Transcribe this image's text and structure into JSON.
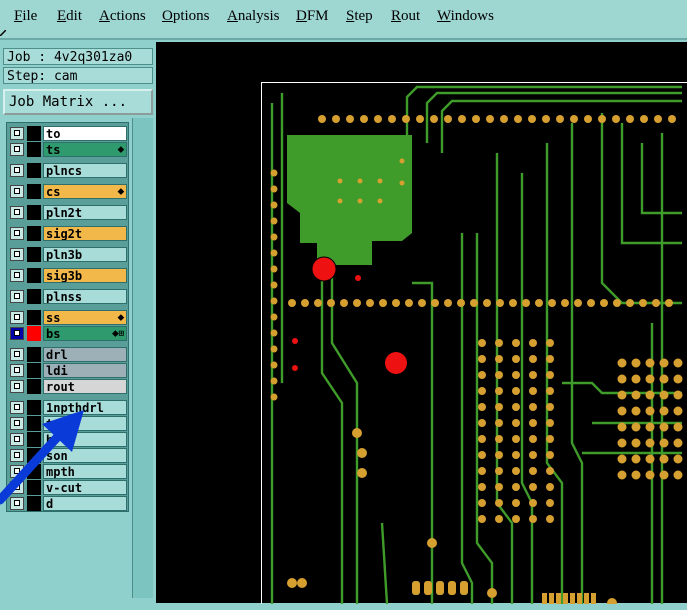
{
  "menu": {
    "items": [
      {
        "label": "File",
        "ul": "F",
        "rest": "ile"
      },
      {
        "label": "Edit",
        "ul": "E",
        "rest": "dit"
      },
      {
        "label": "Actions",
        "ul": "A",
        "rest": "ctions"
      },
      {
        "label": "Options",
        "ul": "O",
        "rest": "ptions"
      },
      {
        "label": "Analysis",
        "ul": "A",
        "rest": "nalysis"
      },
      {
        "label": "DFM",
        "ul": "D",
        "rest": "FM"
      },
      {
        "label": "Step",
        "ul": "S",
        "rest": "tep"
      },
      {
        "label": "Rout",
        "ul": "R",
        "rest": "out"
      },
      {
        "label": "Windows",
        "ul": "W",
        "rest": "indows"
      }
    ]
  },
  "job": {
    "label": "Job : 4v2q301za0",
    "step": "Step: cam",
    "matrix_button": "Job Matrix ..."
  },
  "layers": [
    {
      "name": "to",
      "color": "#ffffff",
      "swatch": "#000000",
      "tag": ""
    },
    {
      "name": "ts",
      "color": "#2e9a6e",
      "swatch": "#000000",
      "tag": "⬥"
    },
    {
      "name": "plncs",
      "color": "#a8dcd8",
      "swatch": "#000000",
      "tag": ""
    },
    {
      "name": "cs",
      "color": "#f3b84a",
      "swatch": "#000000",
      "tag": "⬥"
    },
    {
      "name": "pln2t",
      "color": "#a8dcd8",
      "swatch": "#000000",
      "tag": ""
    },
    {
      "name": "sig2t",
      "color": "#f3b84a",
      "swatch": "#000000",
      "tag": ""
    },
    {
      "name": "pln3b",
      "color": "#a8dcd8",
      "swatch": "#000000",
      "tag": ""
    },
    {
      "name": "sig3b",
      "color": "#f3b84a",
      "swatch": "#000000",
      "tag": ""
    },
    {
      "name": "plnss",
      "color": "#a8dcd8",
      "swatch": "#000000",
      "tag": ""
    },
    {
      "name": "ss",
      "color": "#f3b84a",
      "swatch": "#000000",
      "tag": "⬥"
    },
    {
      "name": "bs",
      "color": "#2e9a6e",
      "swatch": "#ff0000",
      "tag": "⬥⊞"
    },
    {
      "name": "drl",
      "color": "#9db0b8",
      "swatch": "#000000",
      "tag": ""
    },
    {
      "name": "ldi",
      "color": "#9db0b8",
      "swatch": "#000000",
      "tag": ""
    },
    {
      "name": "rout",
      "color": "#d6d6d6",
      "swatch": "#000000",
      "tag": ""
    },
    {
      "name": "1npthdrl",
      "color": "#a8dcd8",
      "swatch": "#000000",
      "tag": ""
    },
    {
      "name": "tp",
      "color": "#a8dcd8",
      "swatch": "#000000",
      "tag": ""
    },
    {
      "name": "b",
      "color": "#a8dcd8",
      "swatch": "#000000",
      "tag": ""
    },
    {
      "name": "son",
      "color": "#a8dcd8",
      "swatch": "#000000",
      "tag": ""
    },
    {
      "name": "mpth",
      "color": "#a8dcd8",
      "swatch": "#000000",
      "tag": ""
    },
    {
      "name": "v-cut",
      "color": "#a8dcd8",
      "swatch": "#000000",
      "tag": ""
    },
    {
      "name": "d",
      "color": "#a8dcd8",
      "swatch": "#000000",
      "tag": ""
    }
  ],
  "colors": {
    "trace": "#3f9b2a",
    "pad": "#d6a030",
    "drill": "#ee1111",
    "arrow": "#0a3ad8"
  }
}
